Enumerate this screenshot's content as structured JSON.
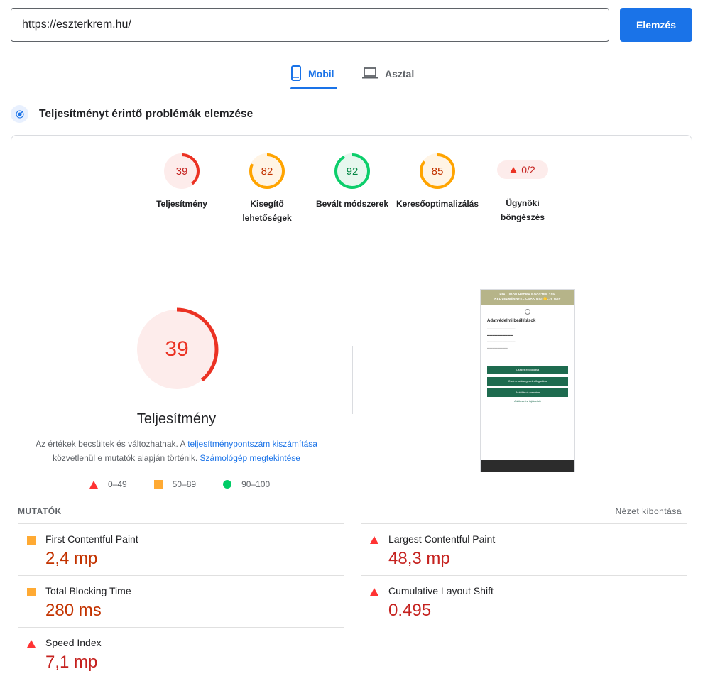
{
  "search": {
    "url": "https://eszterkrem.hu/",
    "analyze_label": "Elemzés"
  },
  "tabs": {
    "mobile": "Mobil",
    "desktop": "Asztal"
  },
  "section_title": "Teljesítményt érintő problémák elemzése",
  "categories": [
    {
      "score": 39,
      "label_line1": "Teljesítmény",
      "label_line2": "",
      "status": "fail"
    },
    {
      "score": 82,
      "label_line1": "Kisegítő",
      "label_line2": "lehetőségek",
      "status": "average"
    },
    {
      "score": 92,
      "label_line1": "Bevált módszerek",
      "label_line2": "",
      "status": "pass"
    },
    {
      "score": 85,
      "label_line1": "Keresőoptimalizálás",
      "label_line2": "",
      "status": "average"
    }
  ],
  "agentic": {
    "badge": "0/2",
    "label_line1": "Ügynöki",
    "label_line2": "böngészés"
  },
  "performance": {
    "score": "39",
    "label": "Teljesítmény",
    "note_part1": "Az értékek becsültek és változhatnak. A ",
    "note_link1": "teljesítménypontszám kiszámítása",
    "note_part2": " közvetlenül e mutatók alapján történik. ",
    "note_link2": "Számológép megtekintése"
  },
  "legend": {
    "fail": "0–49",
    "average": "50–89",
    "pass": "90–100"
  },
  "screenshot": {
    "banner_line1": "HIALURON HYDRA BOOSTER 20%",
    "banner_line2": "KEDVEZMÉNNYEL CSAK MA! 🟡...6 NAP",
    "title": "Adatvédelmi beállítások",
    "btn1": "Összes elfogadása",
    "btn2": "Csak a szükségesek elfogadása",
    "btn3": "Beállítások mentése",
    "link": "Adatkezelési tájékoztató"
  },
  "metrics": {
    "title": "MUTATÓK",
    "expand": "Nézet kibontása",
    "fcp": {
      "label": "First Contentful Paint",
      "value": "2,4 mp"
    },
    "lcp": {
      "label": "Largest Contentful Paint",
      "value": "48,3 mp"
    },
    "tbt": {
      "label": "Total Blocking Time",
      "value": "280 ms"
    },
    "cls": {
      "label": "Cumulative Layout Shift",
      "value": "0.495"
    },
    "si": {
      "label": "Speed Index",
      "value": "7,1 mp"
    }
  },
  "colors": {
    "accent": "#1a73e8",
    "fail": "#eb3223",
    "average": "#ffa400",
    "pass": "#0cce6b"
  }
}
